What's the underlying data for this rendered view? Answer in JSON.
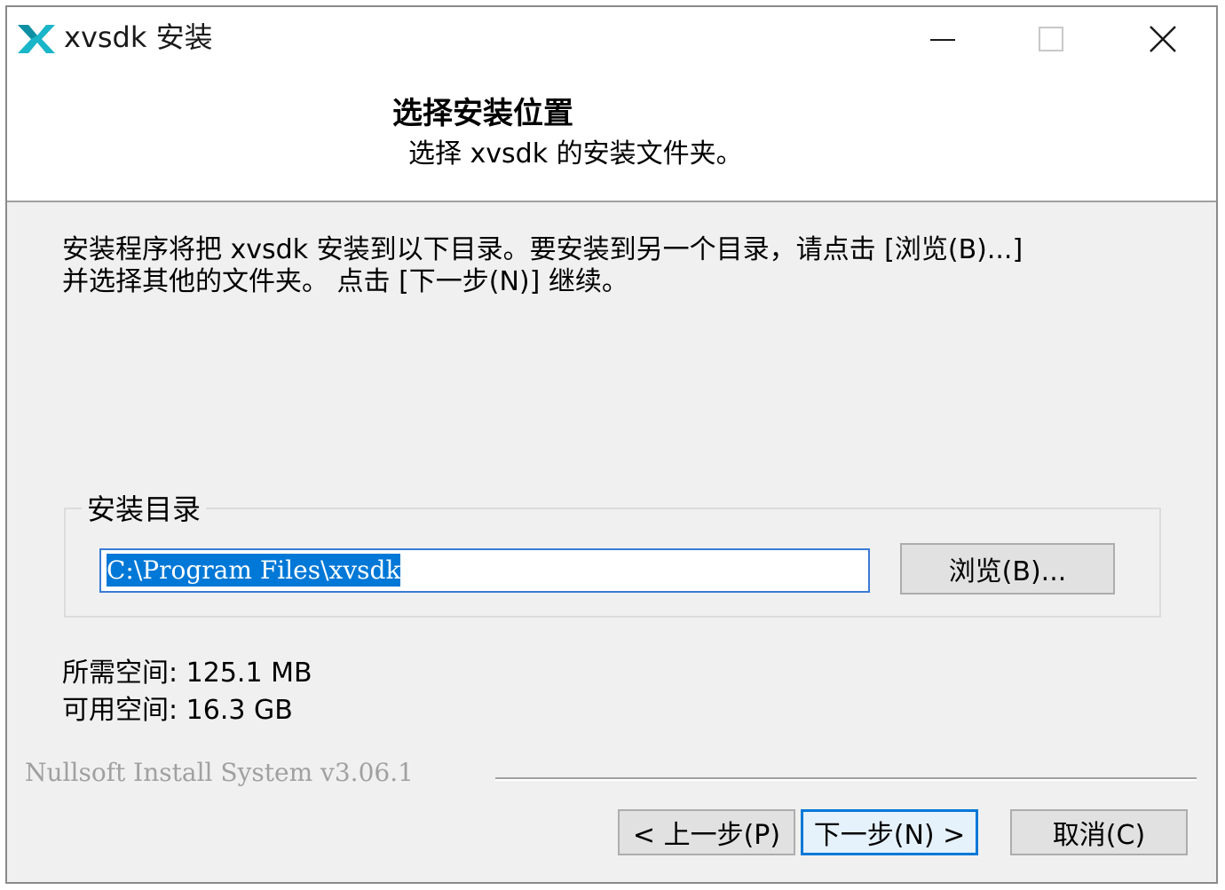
{
  "window": {
    "title": "xvsdk 安装",
    "icon": "xvsdk-logo-icon",
    "controls": {
      "minimize": "minimize-icon",
      "maximize": "maximize-icon",
      "close": "close-icon"
    }
  },
  "header": {
    "title": "选择安装位置",
    "subtitle": "选择 xvsdk 的安装文件夹。"
  },
  "intro": {
    "line1": "安装程序将把 xvsdk 安装到以下目录。要安装到另一个目录，请点击 [浏览(B)...]",
    "line2": "并选择其他的文件夹。 点击 [下一步(N)] 继续。"
  },
  "install_dir": {
    "group_label": "安装目录",
    "path": "C:\\Program Files\\xvsdk",
    "browse_label": "浏览(B)..."
  },
  "space": {
    "required": "所需空间: 125.1 MB",
    "available": "可用空间: 16.3 GB"
  },
  "footer": {
    "branding": "Nullsoft Install System v3.06.1",
    "back_label": "< 上一步(P)",
    "next_label": "下一步(N) >",
    "cancel_label": "取消(C)"
  },
  "colors": {
    "accent": "#0078d7",
    "logo": "#19b5c8",
    "panel": "#f0f0f0"
  }
}
